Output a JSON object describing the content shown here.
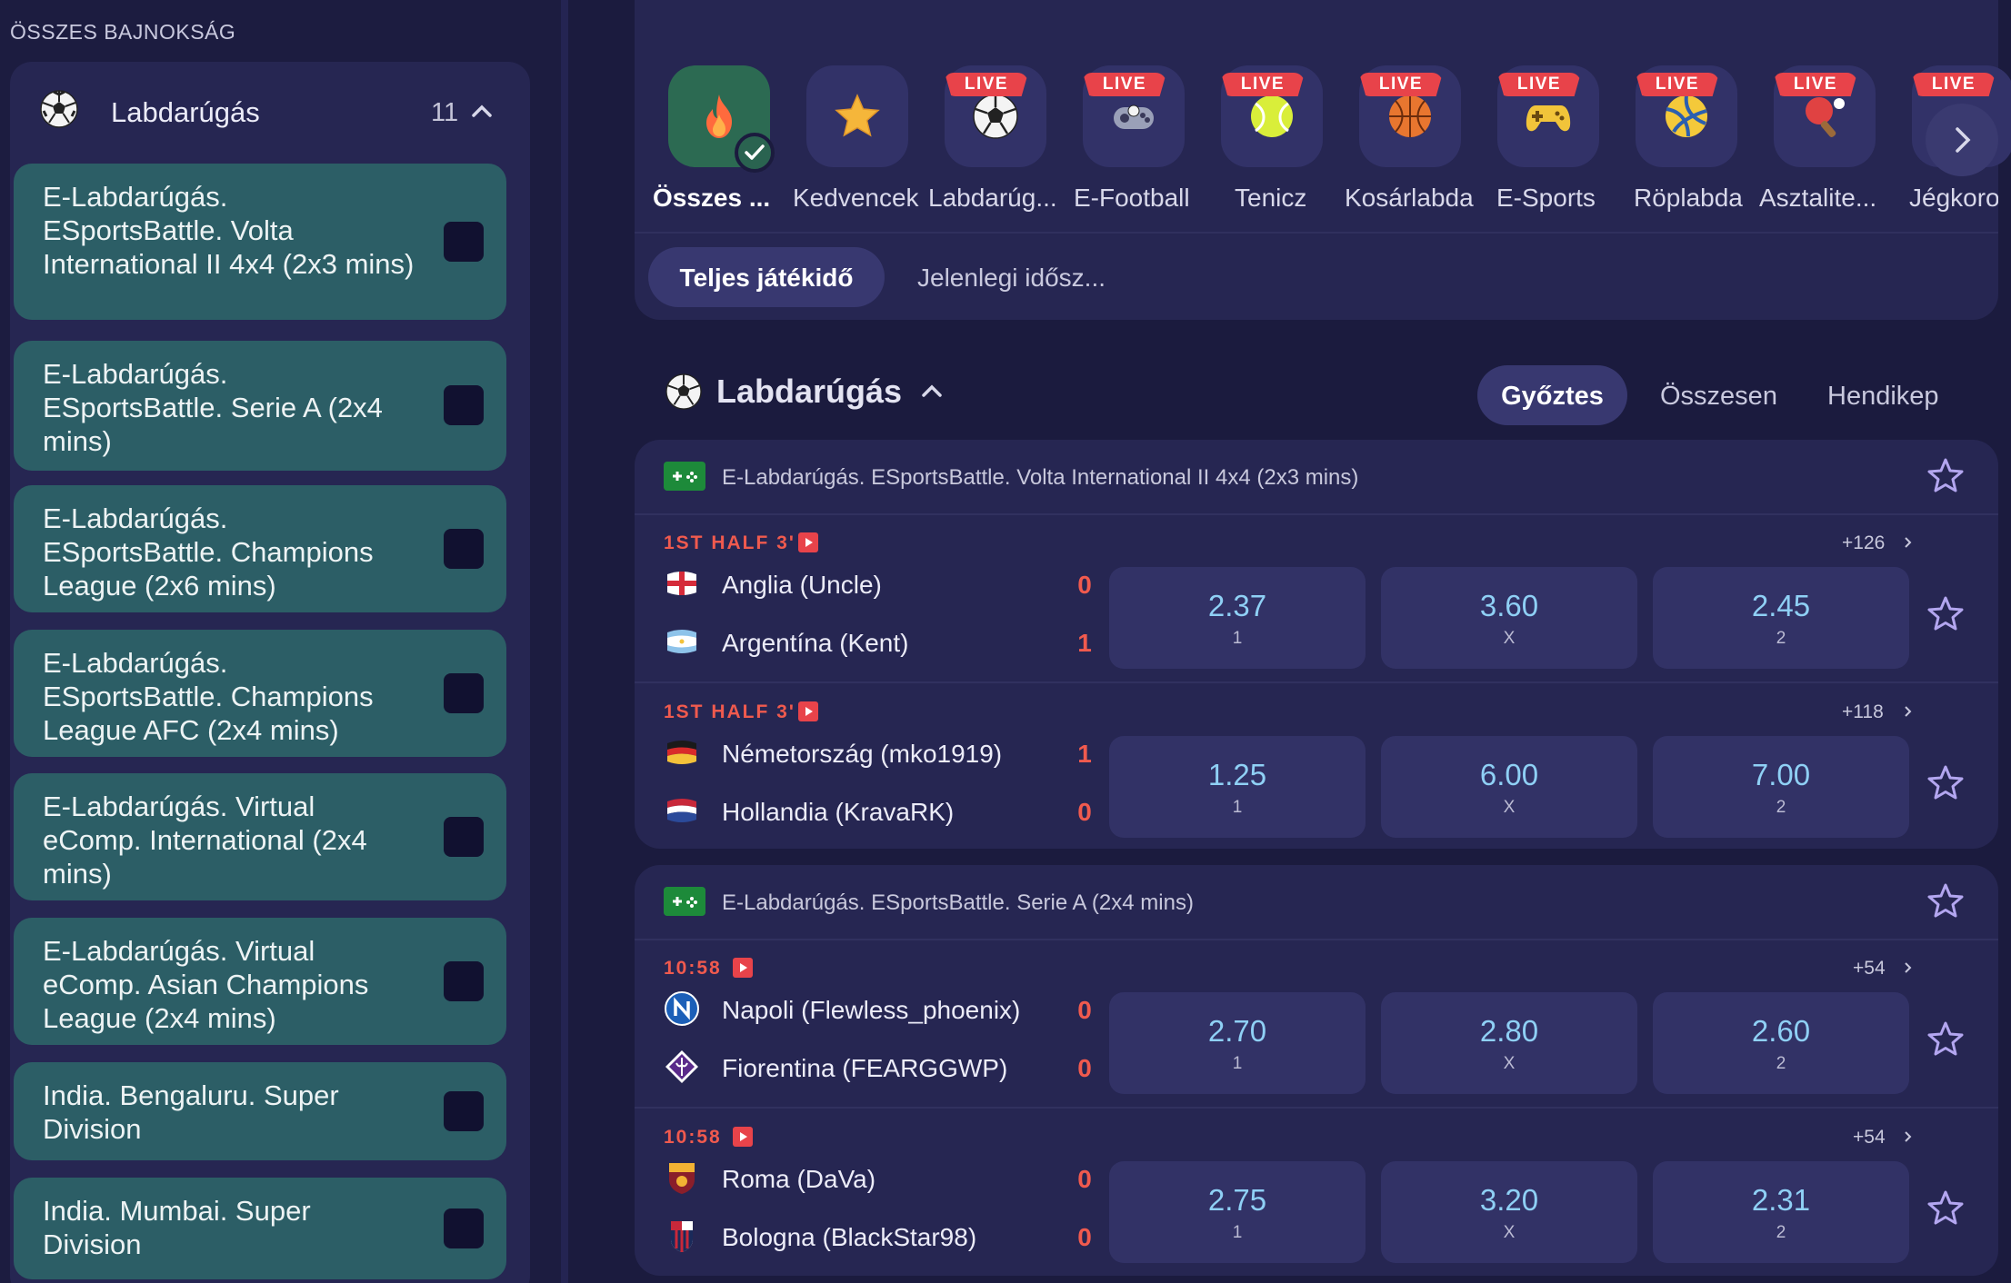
{
  "sidebar": {
    "heading": "ÖSSZES BAJNOKSÁG",
    "sport": {
      "name": "Labdarúgás",
      "count": "11",
      "icon": "soccer-ball-icon"
    },
    "leagues": [
      {
        "label": "E-Labdarúgás. ESportsBattle. Volta International II 4x4 (2x3 mins)"
      },
      {
        "label": "E-Labdarúgás. ESportsBattle. Serie A (2x4 mins)"
      },
      {
        "label": "E-Labdarúgás. ESportsBattle. Champions League (2x6 mins)"
      },
      {
        "label": "E-Labdarúgás. ESportsBattle. Champions League AFC (2x4 mins)"
      },
      {
        "label": "E-Labdarúgás. Virtual eComp. International (2x4 mins)"
      },
      {
        "label": "E-Labdarúgás. Virtual eComp. Asian Champions League (2x4 mins)"
      },
      {
        "label": "India. Bengaluru. Super Division"
      },
      {
        "label": "India. Mumbai. Super Division"
      }
    ]
  },
  "categories": {
    "live_label": "LIVE",
    "items": [
      {
        "label": "Összes ...",
        "icon": "fire-icon",
        "live": false,
        "active": true
      },
      {
        "label": "Kedvencek",
        "icon": "star-icon",
        "live": false,
        "active": false
      },
      {
        "label": "Labdarúg...",
        "icon": "soccer-ball-icon",
        "live": true,
        "active": false
      },
      {
        "label": "E-Football",
        "icon": "gamepad-icon",
        "live": true,
        "active": false
      },
      {
        "label": "Tenicz",
        "icon": "tennis-ball-icon",
        "live": true,
        "active": false
      },
      {
        "label": "Kosárlabda",
        "icon": "basketball-icon",
        "live": true,
        "active": false
      },
      {
        "label": "E-Sports",
        "icon": "joystick-icon",
        "live": true,
        "active": false
      },
      {
        "label": "Röplabda",
        "icon": "volleyball-icon",
        "live": true,
        "active": false
      },
      {
        "label": "Asztalite...",
        "icon": "ping-pong-icon",
        "live": true,
        "active": false
      },
      {
        "label": "Jégkoron",
        "icon": "hockey-icon",
        "live": true,
        "active": false
      }
    ]
  },
  "period_filter": {
    "active": "Teljes játékidő",
    "other": "Jelenlegi idősz..."
  },
  "section": {
    "title": "Labdarúgás",
    "tabs": {
      "active": "Győztes",
      "second": "Összesen",
      "third": "Hendikep"
    }
  },
  "leagues": [
    {
      "title": "E-Labdarúgás. ESportsBattle. Volta International II 4x4 (2x3 mins)",
      "matches": [
        {
          "time": "1ST HALF 3'",
          "more": "+126",
          "home": {
            "name": "Anglia (Uncle)",
            "score": "0",
            "icon": "england-flag-icon"
          },
          "away": {
            "name": "Argentína (Kent)",
            "score": "1",
            "icon": "argentina-flag-icon"
          },
          "odds": [
            {
              "v": "2.37",
              "k": "1"
            },
            {
              "v": "3.60",
              "k": "X"
            },
            {
              "v": "2.45",
              "k": "2"
            }
          ]
        },
        {
          "time": "1ST HALF 3'",
          "more": "+118",
          "home": {
            "name": "Németország (mko1919)",
            "score": "1",
            "icon": "germany-flag-icon"
          },
          "away": {
            "name": "Hollandia (KravaRK)",
            "score": "0",
            "icon": "netherlands-flag-icon"
          },
          "odds": [
            {
              "v": "1.25",
              "k": "1"
            },
            {
              "v": "6.00",
              "k": "X"
            },
            {
              "v": "7.00",
              "k": "2"
            }
          ]
        }
      ]
    },
    {
      "title": "E-Labdarúgás. ESportsBattle. Serie A (2x4 mins)",
      "matches": [
        {
          "time": "10:58",
          "more": "+54",
          "home": {
            "name": "Napoli (Flewless_phoenix)",
            "score": "0",
            "icon": "napoli-crest-icon"
          },
          "away": {
            "name": "Fiorentina (FEARGGWP)",
            "score": "0",
            "icon": "fiorentina-crest-icon"
          },
          "odds": [
            {
              "v": "2.70",
              "k": "1"
            },
            {
              "v": "2.80",
              "k": "X"
            },
            {
              "v": "2.60",
              "k": "2"
            }
          ]
        },
        {
          "time": "10:58",
          "more": "+54",
          "home": {
            "name": "Roma (DaVa)",
            "score": "0",
            "icon": "roma-crest-icon"
          },
          "away": {
            "name": "Bologna (BlackStar98)",
            "score": "0",
            "icon": "bologna-crest-icon"
          },
          "odds": [
            {
              "v": "2.75",
              "k": "1"
            },
            {
              "v": "3.20",
              "k": "X"
            },
            {
              "v": "2.31",
              "k": "2"
            }
          ]
        }
      ]
    }
  ],
  "colors": {
    "background": "#1b1b3e",
    "panel": "#262652",
    "league_item": "#2c5e66",
    "live_badge": "#e8434a",
    "odds_value": "#8fd0f5",
    "score": "#f05a4e"
  }
}
